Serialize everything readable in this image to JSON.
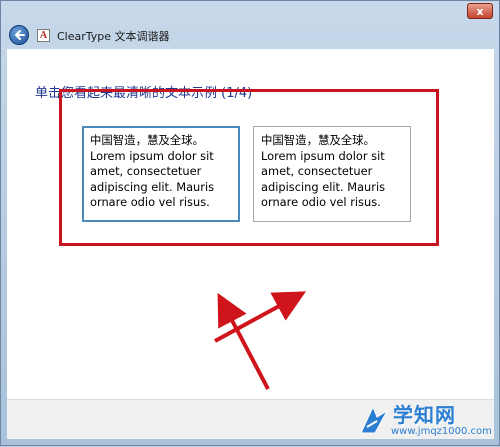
{
  "window": {
    "title": "ClearType 文本调谐器",
    "close_glyph": "x"
  },
  "page": {
    "heading": "单击您看起来最清晰的文本示例 (1/4)"
  },
  "samples": [
    {
      "line_cn": "中国智造，慧及全球。",
      "line_1": "Lorem ipsum dolor sit",
      "line_2": "amet, consectetuer",
      "line_3": "adipiscing elit. Mauris",
      "line_4": "ornare odio vel risus.",
      "selected": true
    },
    {
      "line_cn": "中国智造，慧及全球。",
      "line_1": "Lorem ipsum dolor sit",
      "line_2": "amet, consectetuer",
      "line_3": "adipiscing elit. Mauris",
      "line_4": "ornare odio vel risus.",
      "selected": false
    }
  ],
  "annotation": {
    "box_color": "#c8141e",
    "arrow_color": "#d0141c"
  },
  "watermark": {
    "name": "学知网",
    "url": "www.jmqz1000.com"
  },
  "icons": {
    "back": "back-arrow-icon",
    "app": "cleartype-icon",
    "close": "close-icon"
  }
}
